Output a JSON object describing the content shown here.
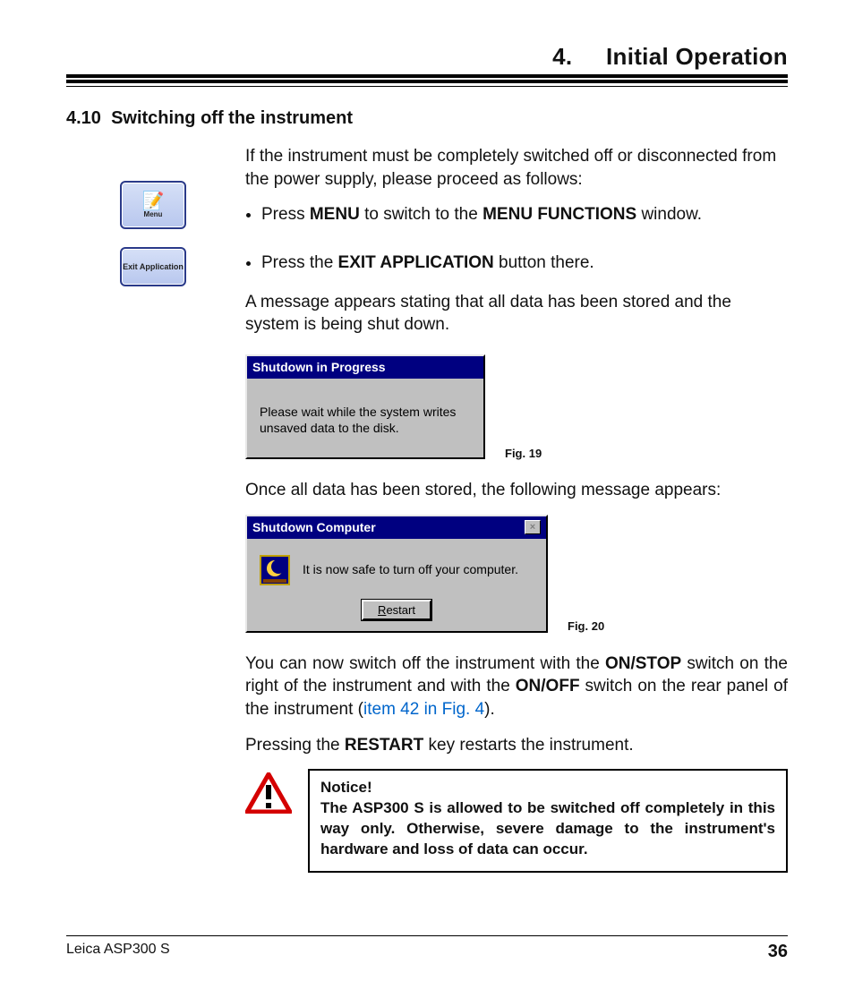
{
  "header": {
    "chapter_number": "4.",
    "chapter_title": "Initial Operation"
  },
  "section": {
    "number": "4.10",
    "title": "Switching off the instrument"
  },
  "side_buttons": {
    "menu_label": "Menu",
    "exit_label": "Exit Application"
  },
  "paragraphs": {
    "intro": "If the instrument must be completely switched off or disconnected from the power supply, please proceed as follows:",
    "bullet1_pre": "Press ",
    "bullet1_b1": "MENU",
    "bullet1_mid": " to switch to the ",
    "bullet1_b2": "MENU FUNCTIONS",
    "bullet1_post": " window.",
    "bullet2_pre": "Press the ",
    "bullet2_b1": "EXIT APPLICATION",
    "bullet2_post": " button there.",
    "after_exit": "A message appears stating that all data has been stored and the system is being shut down.",
    "after_dlg1": "Once all data has been stored, the following message appears:",
    "after_dlg2_1": "You can now switch off the instrument with the ",
    "after_dlg2_b1": "ON/STOP",
    "after_dlg2_2": " switch on the right of the instrument and with the ",
    "after_dlg2_b2": "ON/OFF",
    "after_dlg2_3": " switch on the rear panel of the instrument (",
    "after_dlg2_link": "item 42 in Fig. 4",
    "after_dlg2_4": ").",
    "restart_pre": "Pressing the ",
    "restart_b": "RESTART",
    "restart_post": " key restarts the instrument."
  },
  "dialog1": {
    "title": "Shutdown in Progress",
    "body": "Please wait while the system writes unsaved data to the disk.",
    "fig": "Fig. 19"
  },
  "dialog2": {
    "title": "Shutdown Computer",
    "body": "It is now safe to turn off your computer.",
    "button_u": "R",
    "button_rest": "estart",
    "fig": "Fig. 20"
  },
  "notice": {
    "heading": "Notice!",
    "body": "The ASP300 S is allowed to be switched off completely in this way only. Otherwise, severe damage to the instrument's hardware and loss of data can occur."
  },
  "footer": {
    "product": "Leica ASP300 S",
    "page": "36"
  }
}
